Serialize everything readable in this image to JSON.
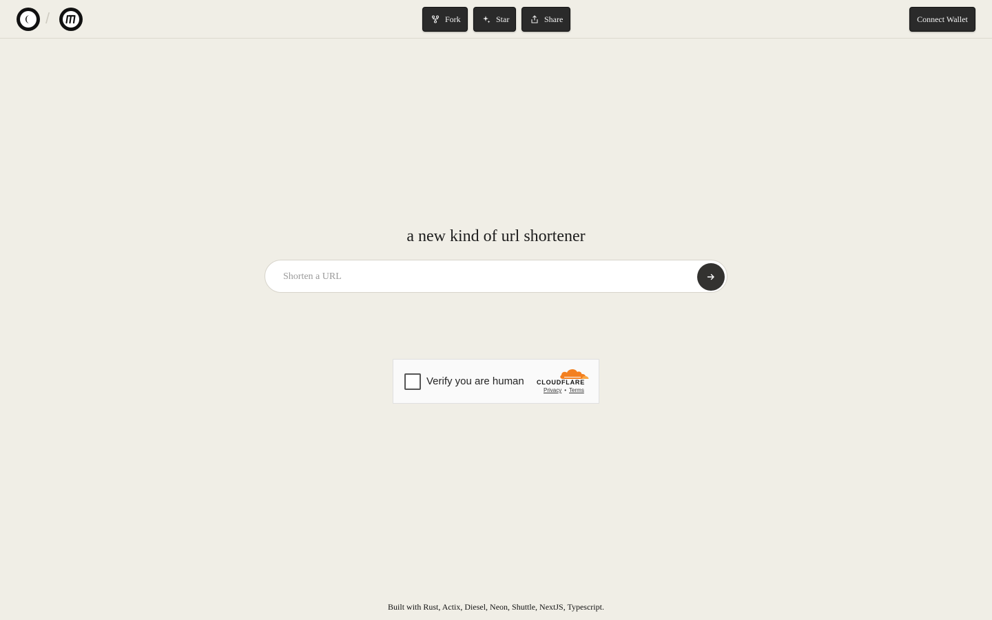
{
  "header": {
    "buttons": {
      "fork": "Fork",
      "star": "Star",
      "share": "Share"
    },
    "wallet_label": "Connect Wallet"
  },
  "hero": {
    "title": "a new kind of url shortener",
    "input_placeholder": "Shorten a URL"
  },
  "captcha": {
    "label": "Verify you are human",
    "brand": "CLOUDFLARE",
    "privacy": "Privacy",
    "terms": "Terms",
    "separator": "•"
  },
  "footer": {
    "text": "Built with Rust, Actix, Diesel, Neon, Shuttle, NextJS, Typescript."
  },
  "icons": {
    "logo_left": "crescent-logo-icon",
    "logo_right": "stroke-logo-icon",
    "fork": "fork-icon",
    "star": "sparkle-icon",
    "share": "share-icon",
    "submit": "arrow-right-icon",
    "cloudflare": "cloudflare-cloud-icon"
  },
  "colors": {
    "background": "#f0eee6",
    "button": "#2a2a2a",
    "cloudflare_orange": "#f38020"
  }
}
